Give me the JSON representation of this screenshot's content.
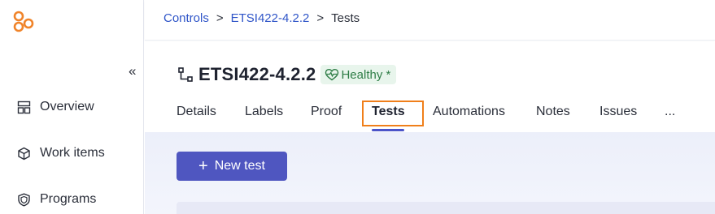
{
  "sidebar": {
    "collapse_glyph": "«",
    "items": [
      {
        "label": "Overview",
        "icon": "layout-icon"
      },
      {
        "label": "Work items",
        "icon": "box-icon"
      },
      {
        "label": "Programs",
        "icon": "shield-icon"
      }
    ]
  },
  "breadcrumb": {
    "items": [
      "Controls",
      "ETSI422-4.2.2",
      "Tests"
    ],
    "separator": ">"
  },
  "header": {
    "title": "ETSI422-4.2.2",
    "status_badge": "Healthy *",
    "status_color": "#2e7d46"
  },
  "tabs": {
    "items": [
      "Details",
      "Labels",
      "Proof",
      "Tests",
      "Automations",
      "Notes",
      "Issues",
      "..."
    ],
    "active": "Tests"
  },
  "actions": {
    "new_test_plus": "+",
    "new_test_label": "New test"
  },
  "colors": {
    "accent": "#4f56c0",
    "link": "#2f55c8",
    "highlight": "#f07f1a",
    "logo": "#f0842a"
  }
}
